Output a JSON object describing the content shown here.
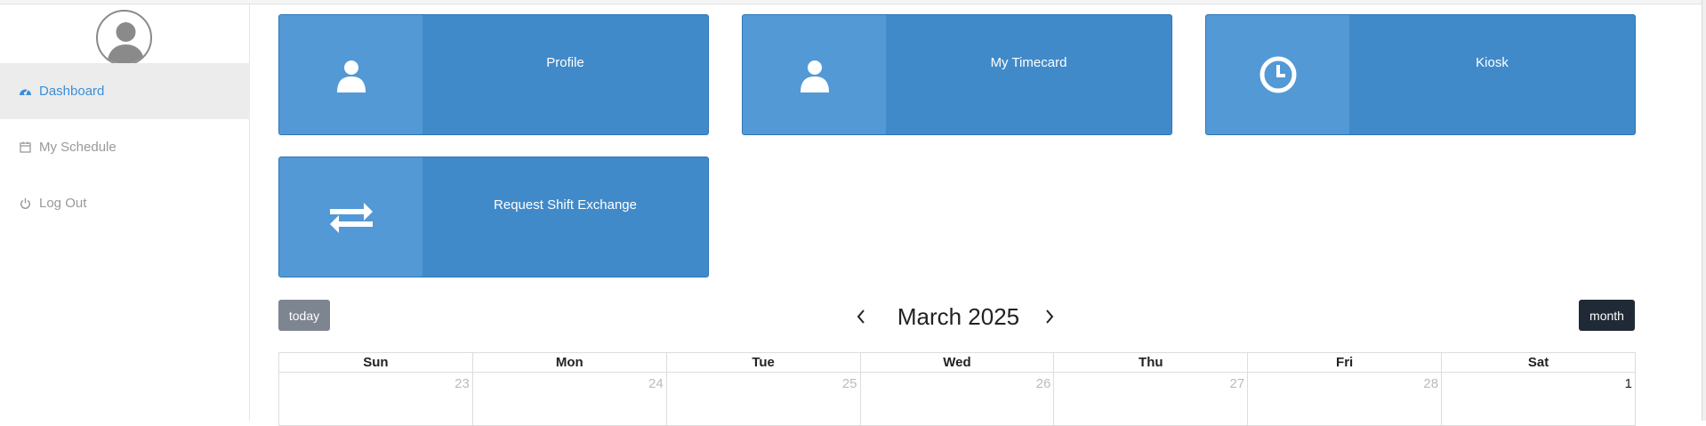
{
  "sidebar": {
    "items": [
      {
        "label": "Dashboard",
        "icon": "dashboard-icon",
        "active": true
      },
      {
        "label": "My Schedule",
        "icon": "calendar-icon",
        "active": false
      },
      {
        "label": "Log Out",
        "icon": "power-icon",
        "active": false
      }
    ]
  },
  "tiles": [
    {
      "label": "Profile",
      "icon": "user-icon"
    },
    {
      "label": "My Timecard",
      "icon": "user-icon"
    },
    {
      "label": "Kiosk",
      "icon": "clock-icon"
    },
    {
      "label": "Request Shift Exchange",
      "icon": "exchange-arrows-icon"
    }
  ],
  "calendar": {
    "today_label": "today",
    "month_label": "month",
    "title": "March 2025",
    "weekdays": [
      "Sun",
      "Mon",
      "Tue",
      "Wed",
      "Thu",
      "Fri",
      "Sat"
    ],
    "first_week": [
      "23",
      "24",
      "25",
      "26",
      "27",
      "28",
      "1"
    ]
  },
  "colors": {
    "accent": "#3a8fd8",
    "tile_bg": "#418ac9",
    "tile_icon_bg": "#5399d6",
    "today_btn": "#7d8591",
    "month_btn": "#1f2a36"
  }
}
